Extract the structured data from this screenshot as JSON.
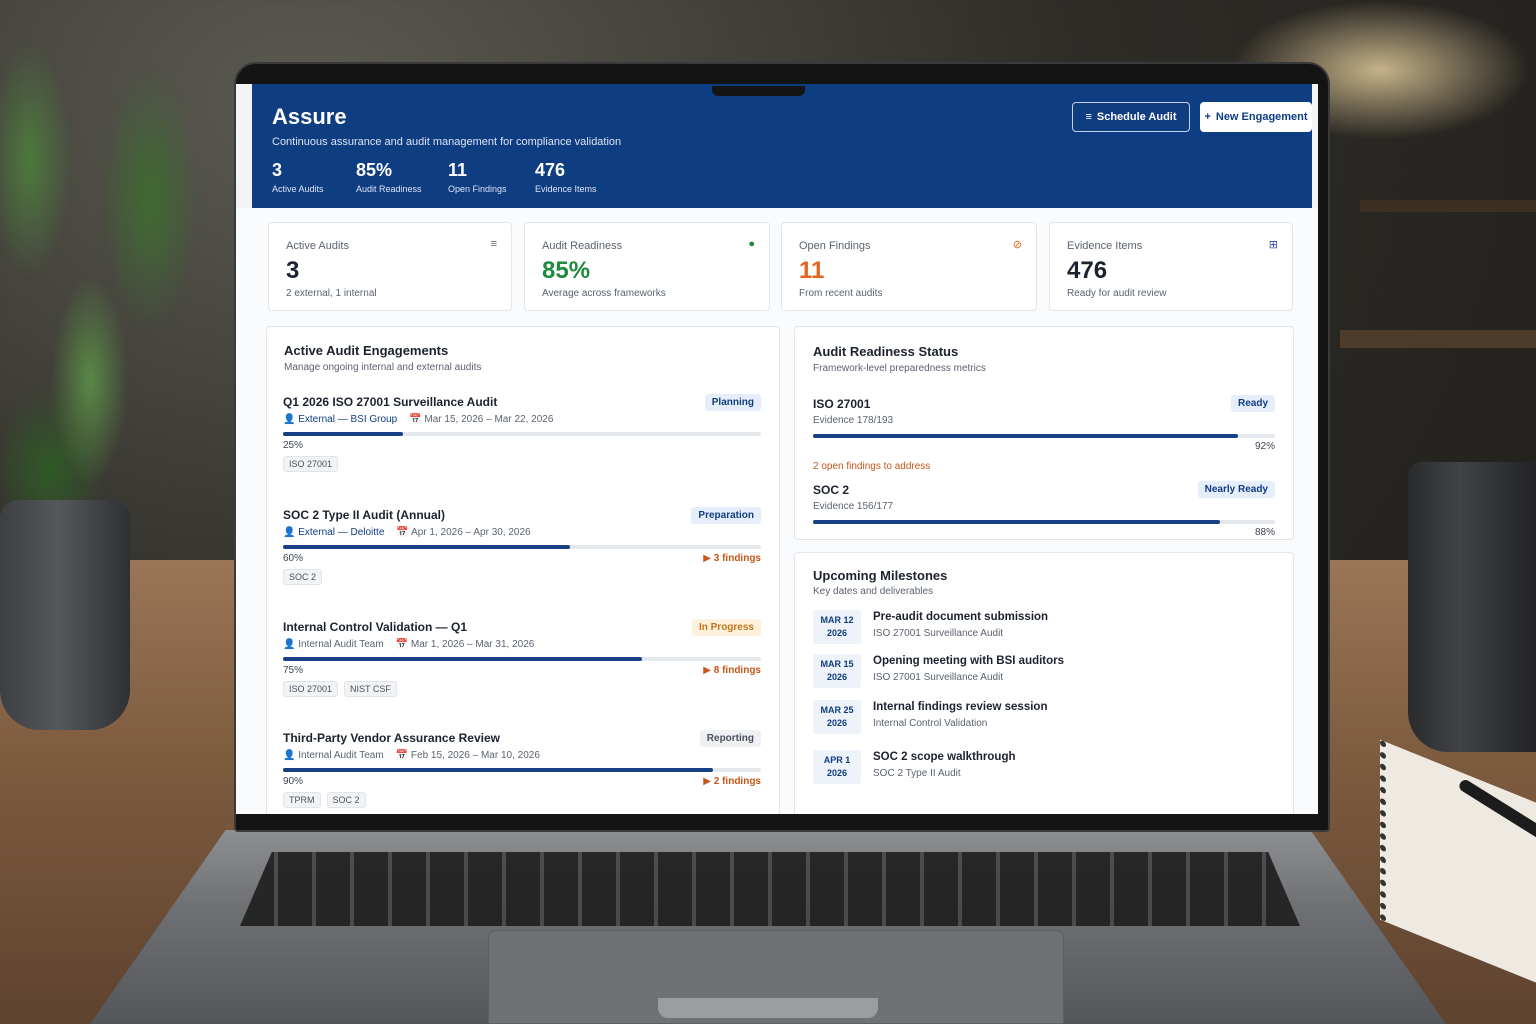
{
  "app": {
    "title": "Assure",
    "subtitle": "Continuous assurance and audit management for compliance validation",
    "actions": {
      "schedule_icon": "≡",
      "schedule_label": "Schedule Audit",
      "new_icon": "+",
      "new_label": "New Engagement"
    },
    "hero_stats": [
      {
        "value": "3",
        "label": "Active Audits"
      },
      {
        "value": "85%",
        "label": "Audit Readiness"
      },
      {
        "value": "11",
        "label": "Open Findings"
      },
      {
        "value": "476",
        "label": "Evidence Items"
      }
    ]
  },
  "kpis": [
    {
      "label": "Active Audits",
      "value": "3",
      "sub": "2 external, 1 internal",
      "icon": "list-icon",
      "glyph": "≡",
      "color": "#5b6270"
    },
    {
      "label": "Audit Readiness",
      "value": "85%",
      "sub": "Average across frameworks",
      "icon": "status-dot-icon",
      "glyph": "●",
      "color": "#1e8a3e"
    },
    {
      "label": "Open Findings",
      "value": "11",
      "sub": "From recent audits",
      "icon": "blocked-icon",
      "glyph": "⊘",
      "color": "#e0661f"
    },
    {
      "label": "Evidence Items",
      "value": "476",
      "sub": "Ready for audit review",
      "icon": "grid-icon",
      "glyph": "⊞",
      "color": "#2f49a8"
    }
  ],
  "engagements": {
    "title": "Active Audit Engagements",
    "subtitle": "Manage ongoing internal and external audits",
    "items": [
      {
        "name": "Q1 2026 ISO 27001 Surveillance Audit",
        "status": "Planning",
        "who_type": "External",
        "who_org": "BSI Group",
        "dates": "Mar 15, 2026 – Mar 22, 2026",
        "progress": 25,
        "progress_label": "25%",
        "findings": "",
        "tags": [
          "ISO 27001"
        ]
      },
      {
        "name": "SOC 2 Type II Audit (Annual)",
        "status": "Preparation",
        "who_type": "External",
        "who_org": "Deloitte",
        "dates": "Apr 1, 2026 – Apr 30, 2026",
        "progress": 60,
        "progress_label": "60%",
        "findings": "3 findings",
        "tags": [
          "SOC 2"
        ]
      },
      {
        "name": "Internal Control Validation — Q1",
        "status": "In Progress",
        "who_type": "",
        "who_org": "Internal Audit Team",
        "dates": "Mar 1, 2026 – Mar 31, 2026",
        "progress": 75,
        "progress_label": "75%",
        "findings": "8 findings",
        "tags": [
          "ISO 27001",
          "NIST CSF"
        ]
      },
      {
        "name": "Third-Party Vendor Assurance Review",
        "status": "Reporting",
        "who_type": "",
        "who_org": "Internal Audit Team",
        "dates": "Feb 15, 2026 – Mar 10, 2026",
        "progress": 90,
        "progress_label": "90%",
        "findings": "2 findings",
        "tags": [
          "TPRM",
          "SOC 2"
        ]
      }
    ]
  },
  "readiness": {
    "title": "Audit Readiness Status",
    "subtitle": "Framework-level preparedness metrics",
    "items": [
      {
        "name": "ISO 27001",
        "status": "Ready",
        "evidence": "Evidence 178/193",
        "progress": 92,
        "progress_label": "92%",
        "warning": "2 open findings to address"
      },
      {
        "name": "SOC 2",
        "status": "Nearly Ready",
        "evidence": "Evidence 156/177",
        "progress": 88,
        "progress_label": "88%",
        "warning": ""
      }
    ]
  },
  "milestones": {
    "title": "Upcoming Milestones",
    "subtitle": "Key dates and deliverables",
    "items": [
      {
        "month_day": "MAR 12",
        "year": "2026",
        "title": "Pre-audit document submission",
        "sub": "ISO 27001 Surveillance Audit"
      },
      {
        "month_day": "MAR 15",
        "year": "2026",
        "title": "Opening meeting with BSI auditors",
        "sub": "ISO 27001 Surveillance Audit"
      },
      {
        "month_day": "MAR 25",
        "year": "2026",
        "title": "Internal findings review session",
        "sub": "Internal Control Validation"
      },
      {
        "month_day": "APR 1",
        "year": "2026",
        "title": "SOC 2 scope walkthrough",
        "sub": "SOC 2 Type II Audit"
      }
    ]
  },
  "icons": {
    "person": "👤",
    "calendar": "📅",
    "flag": "▶"
  }
}
